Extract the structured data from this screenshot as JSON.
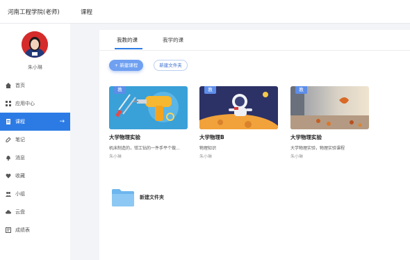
{
  "header": {
    "school": "河南工程学院(老师)",
    "breadcrumb": "课程"
  },
  "user": {
    "name": "朱小琳"
  },
  "nav": [
    {
      "label": "首页",
      "icon": "home-icon"
    },
    {
      "label": "应用中心",
      "icon": "apps-icon"
    },
    {
      "label": "课程",
      "icon": "book-icon",
      "active": true
    },
    {
      "label": "笔记",
      "icon": "note-icon"
    },
    {
      "label": "消息",
      "icon": "bell-icon"
    },
    {
      "label": "收藏",
      "icon": "heart-icon"
    },
    {
      "label": "小组",
      "icon": "group-icon"
    },
    {
      "label": "云盘",
      "icon": "cloud-icon"
    },
    {
      "label": "成绩表",
      "icon": "grade-icon"
    }
  ],
  "tabs": {
    "teaching": "我教的课",
    "learning": "我学的课"
  },
  "buttons": {
    "new_course": "+ 新建课程",
    "new_folder": "新建文件夹"
  },
  "courses": [
    {
      "badge": "教",
      "title": "大学物理实验",
      "desc": "机床制造的，钳工钻的一件手平个做...",
      "teacher": "朱小琳"
    },
    {
      "badge": "教",
      "title": "大学物理B",
      "desc": "物理知识",
      "teacher": "朱小琳"
    },
    {
      "badge": "教",
      "title": "大学物理实验",
      "desc": "大学物理实验，物理实验课程",
      "teacher": "朱小琳"
    }
  ],
  "folder": {
    "name": "新建文件夹"
  },
  "colors": {
    "accent": "#2c7be5",
    "folder": "#6db6ee"
  }
}
